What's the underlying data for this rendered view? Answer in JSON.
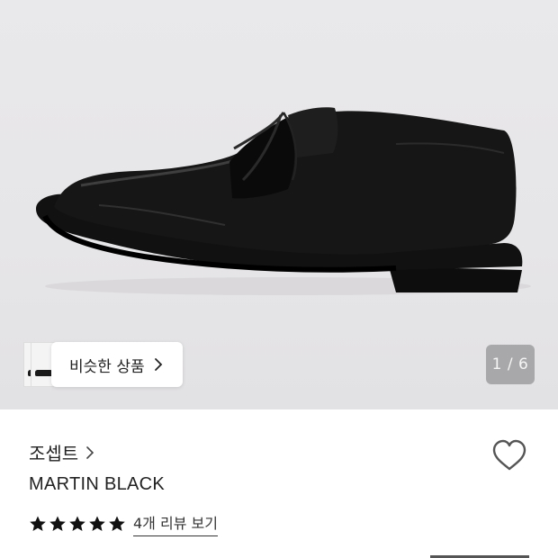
{
  "gallery": {
    "similar_button_label": "비슷한 상품",
    "page_indicator": "1 / 6"
  },
  "product": {
    "brand": "조셉트",
    "name": "MARTIN BLACK",
    "rating_stars": 5,
    "reviews_link": "4개 리뷰 보기"
  },
  "icons": {
    "brand_chevron": "chevron-right-icon",
    "similar_chevron": "chevron-right-icon",
    "wishlist": "heart-outline-icon",
    "star": "star-filled-icon"
  },
  "colors": {
    "hero_background": "#e7e6e8",
    "text": "#222222",
    "pager_background": "#8a8a8c"
  }
}
